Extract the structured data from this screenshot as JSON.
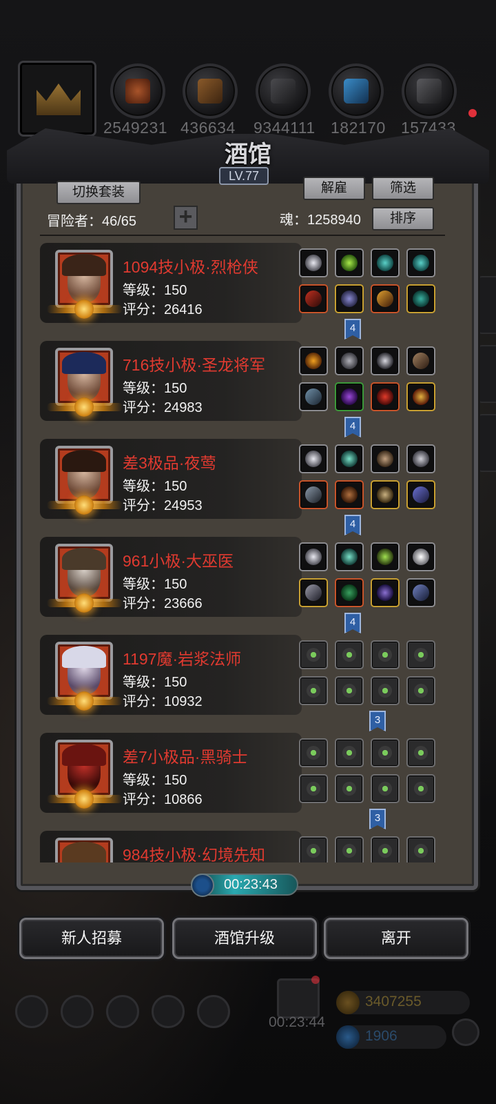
{
  "top_resources": [
    {
      "name": "crown-icon",
      "value": ""
    },
    {
      "name": "meat-icon",
      "value": "2549231"
    },
    {
      "name": "wood-icon",
      "value": "436634"
    },
    {
      "name": "iron-icon",
      "value": "9344111"
    },
    {
      "name": "crystal-icon",
      "value": "182170"
    },
    {
      "name": "steel-icon",
      "value": "157433"
    }
  ],
  "panel": {
    "title": "酒馆",
    "level": "LV.77",
    "switch_outfit_label": "切换套装",
    "dismiss_label": "解雇",
    "filter_label": "筛选",
    "sort_label": "排序",
    "adventurers_text": "冒险者：46/65",
    "soul_text": "魂：1258940",
    "add_label": "+"
  },
  "heroes": [
    {
      "name": "1094技小极·烈枪侠",
      "level_text": "等级：150",
      "score_text": "评分：26416",
      "set_count": "4"
    },
    {
      "name": "716技小极·圣龙将军",
      "level_text": "等级：150",
      "score_text": "评分：24983",
      "set_count": "4"
    },
    {
      "name": "差3极品·夜莺",
      "level_text": "等级：150",
      "score_text": "评分：24953",
      "set_count": "4"
    },
    {
      "name": "961小极·大巫医",
      "level_text": "等级：150",
      "score_text": "评分：23666",
      "set_count": "4"
    },
    {
      "name": "1197魔·岩浆法师",
      "level_text": "等级：150",
      "score_text": "评分：10932",
      "set_count": "3"
    },
    {
      "name": "差7小极品·黑骑士",
      "level_text": "等级：150",
      "score_text": "评分：10866",
      "set_count": "3"
    },
    {
      "name": "984技小极·幻境先知",
      "level_text": "",
      "score_text": "",
      "set_count": ""
    }
  ],
  "timer": {
    "text": "00:23:43"
  },
  "buttons": {
    "recruit_label": "新人招募",
    "upgrade_label": "酒馆升级",
    "leave_label": "离开"
  },
  "hud": {
    "gift_timer": "00:23:44",
    "gold": "3407255",
    "gems": "1906"
  },
  "colors": {
    "hero_name": "#e03a30",
    "set_tag": "#2f5fa4",
    "timer_fill": "#2aa9b0"
  }
}
